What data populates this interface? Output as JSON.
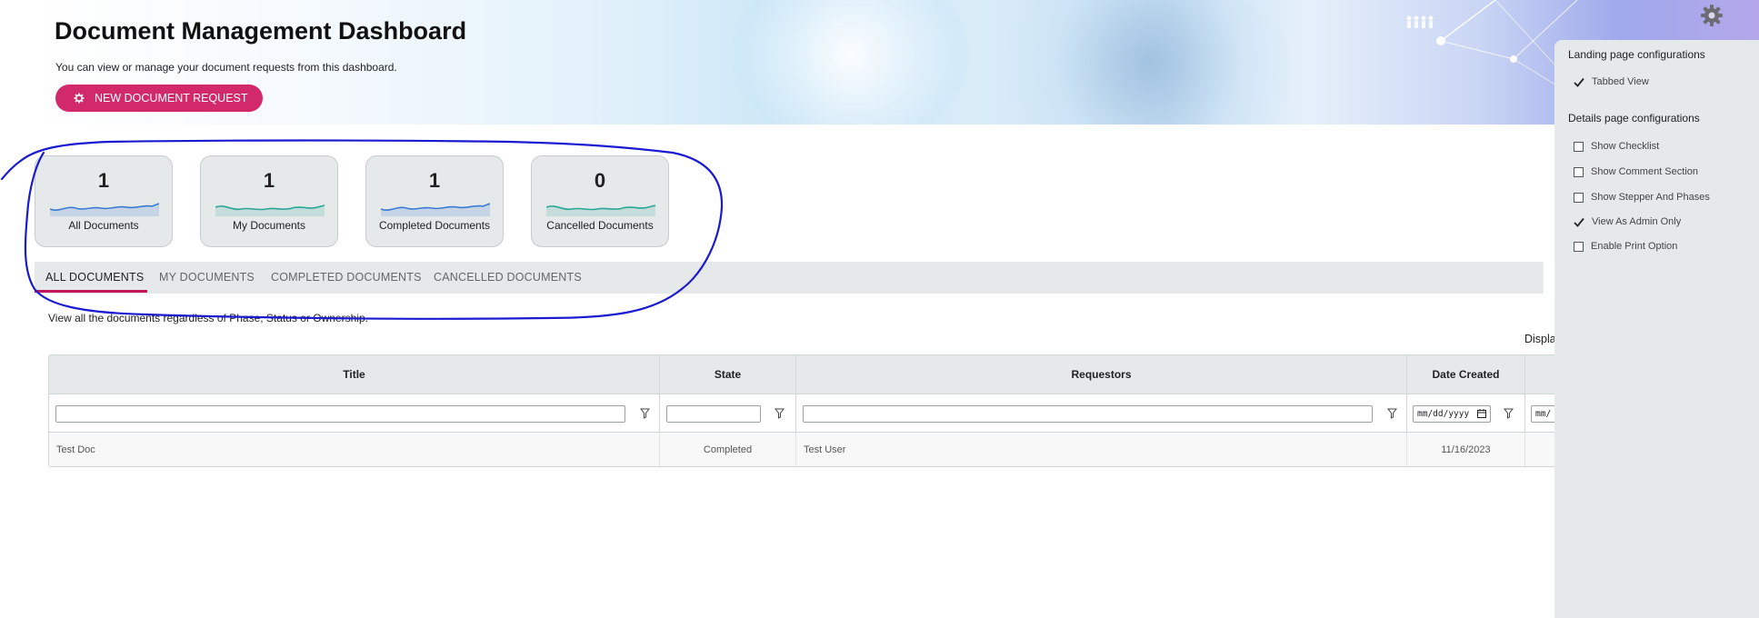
{
  "header": {
    "title": "Document Management Dashboard",
    "subtitle": "You can view or manage your document requests from this dashboard.",
    "new_request_label": "NEW DOCUMENT REQUEST"
  },
  "cards": [
    {
      "count": "1",
      "label": "All Documents",
      "color": "#3a7bd5"
    },
    {
      "count": "1",
      "label": "My Documents",
      "color": "#2aa69a"
    },
    {
      "count": "1",
      "label": "Completed Documents",
      "color": "#3a7bd5"
    },
    {
      "count": "0",
      "label": "Cancelled Documents",
      "color": "#2aa69a"
    }
  ],
  "tabs": [
    {
      "label": "ALL DOCUMENTS",
      "active": true
    },
    {
      "label": "MY DOCUMENTS",
      "active": false
    },
    {
      "label": "COMPLETED DOCUMENTS",
      "active": false
    },
    {
      "label": "CANCELLED DOCUMENTS",
      "active": false
    }
  ],
  "tab_description": "View all the documents regardless of Phase, Status or Ownership.",
  "display_label_partial": "Displa",
  "grid": {
    "columns": [
      "Title",
      "State",
      "Requestors",
      "Date Created"
    ],
    "date_placeholder": "mm/dd/yyyy",
    "date_placeholder_partial": "mm/",
    "rows": [
      {
        "title": "Test Doc",
        "state": "Completed",
        "requestors": "Test User",
        "date_created": "11/16/2023"
      }
    ]
  },
  "settings_panel": {
    "landing_title": "Landing page configurations",
    "landing_options": [
      {
        "label": "Tabbed View",
        "checked": true
      }
    ],
    "details_title": "Details page configurations",
    "details_options": [
      {
        "label": "Show Checklist",
        "checked": false
      },
      {
        "label": "Show Comment Section",
        "checked": false
      },
      {
        "label": "Show Stepper And Phases",
        "checked": false
      },
      {
        "label": "View As Admin Only",
        "checked": true
      },
      {
        "label": "Enable Print Option",
        "checked": false
      }
    ]
  },
  "colors": {
    "accent": "#d1296a",
    "tab_underline": "#c2185b",
    "annotation": "#1a1ad0"
  }
}
